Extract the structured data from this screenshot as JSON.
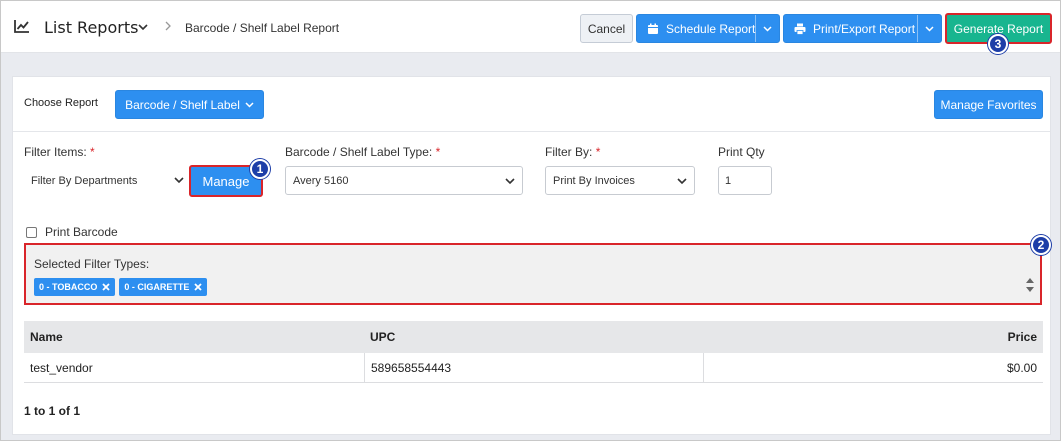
{
  "header": {
    "title": "List Reports",
    "current": "Barcode / Shelf Label Report",
    "cancel_label": "Cancel",
    "schedule_label": "Schedule Report",
    "print_label": "Print/Export Report",
    "generate_label": "Generate Report"
  },
  "choose": {
    "label": "Choose Report",
    "value": "Barcode / Shelf Label",
    "favorites_label": "Manage Favorites"
  },
  "filters": {
    "items_label": "Filter Items:",
    "items_value": "Filter By Departments",
    "manage_label": "Manage",
    "type_label": "Barcode / Shelf Label Type:",
    "type_value": "Avery 5160",
    "by_label": "Filter By:",
    "by_value": "Print By Invoices",
    "qty_label": "Print Qty",
    "qty_value": "1",
    "required_mark": "*"
  },
  "print_barcode_label": "Print Barcode",
  "selected_filters": {
    "title": "Selected Filter Types:",
    "tags": [
      "0 - TOBACCO",
      "0 - CIGARETTE"
    ]
  },
  "table": {
    "columns": [
      "Name",
      "UPC",
      "Price"
    ],
    "rows": [
      {
        "name": "test_vendor",
        "upc": "589658554443",
        "price": "$0.00"
      }
    ]
  },
  "pager": "1 to 1 of 1",
  "badges": [
    "1",
    "2",
    "3"
  ],
  "colors": {
    "primary": "#2d8ff0",
    "success": "#18b58f",
    "highlight": "#d9252a",
    "badge": "#1d3ea8"
  }
}
